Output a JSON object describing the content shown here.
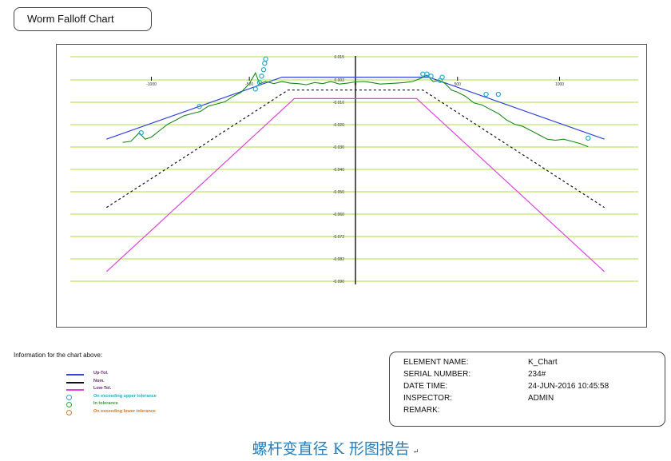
{
  "chart_title": "Worm Falloff Chart",
  "chart_data": {
    "type": "line",
    "title": "Worm Falloff Chart",
    "x_ticks": [
      -1000,
      -520,
      0,
      500,
      1000
    ],
    "x_tick_labels": [
      "-1000",
      "-520",
      "0",
      "500",
      "1000"
    ],
    "y_tick_labels": [
      "0.015",
      "0.002",
      "-0.010",
      "-0.020",
      "-0.030",
      "-0.040",
      "-0.050",
      "-0.060",
      "-0.072",
      "-0.082",
      "-0.090"
    ],
    "xlim": [
      -1250,
      1250
    ],
    "ylim": [
      -0.09,
      0.015
    ],
    "grid": true,
    "series": [
      {
        "name": "Up-Tol.",
        "color": "#3344dd",
        "style": "solid",
        "points": [
          [
            -1220,
            -0.025
          ],
          [
            -360,
            0.004
          ],
          [
            360,
            0.004
          ],
          [
            1220,
            -0.025
          ]
        ]
      },
      {
        "name": "Nom.",
        "color": "#111111",
        "style": "dashed",
        "points": [
          [
            -1220,
            -0.057
          ],
          [
            -330,
            -0.002
          ],
          [
            330,
            -0.002
          ],
          [
            1220,
            -0.057
          ]
        ]
      },
      {
        "name": "Low-Tol.",
        "color": "#dd44dd",
        "style": "solid",
        "points": [
          [
            -1220,
            -0.087
          ],
          [
            -300,
            -0.006
          ],
          [
            300,
            -0.006
          ],
          [
            1220,
            -0.087
          ]
        ]
      },
      {
        "name": "Measured",
        "color": "#1a8a1a",
        "style": "solid",
        "points": [
          [
            -1140,
            -0.0265
          ],
          [
            -1100,
            -0.026
          ],
          [
            -1060,
            -0.022
          ],
          [
            -1030,
            -0.025
          ],
          [
            -1000,
            -0.024
          ],
          [
            -960,
            -0.021
          ],
          [
            -920,
            -0.018
          ],
          [
            -880,
            -0.016
          ],
          [
            -840,
            -0.014
          ],
          [
            -800,
            -0.013
          ],
          [
            -760,
            -0.012
          ],
          [
            -720,
            -0.0095
          ],
          [
            -680,
            -0.0085
          ],
          [
            -640,
            -0.0075
          ],
          [
            -600,
            -0.005
          ],
          [
            -560,
            -0.003
          ],
          [
            -520,
            0.001
          ],
          [
            -490,
            0.006
          ],
          [
            -470,
            0.001
          ],
          [
            -440,
            0.002
          ],
          [
            -400,
            0.001
          ],
          [
            -360,
            0.002
          ],
          [
            -320,
            0.0012
          ],
          [
            -280,
            0.001
          ],
          [
            -240,
            0.0005
          ],
          [
            -200,
            0.0015
          ],
          [
            -160,
            0.001
          ],
          [
            -120,
            0.002
          ],
          [
            -80,
            0.0008
          ],
          [
            -40,
            0.0012
          ],
          [
            0,
            0.0018
          ],
          [
            40,
            0.002
          ],
          [
            80,
            0.0015
          ],
          [
            120,
            0.0008
          ],
          [
            160,
            0.001
          ],
          [
            200,
            0.0012
          ],
          [
            240,
            0.0015
          ],
          [
            280,
            0.002
          ],
          [
            320,
            0.0035
          ],
          [
            350,
            0.005
          ],
          [
            380,
            0.002
          ],
          [
            410,
            0.0025
          ],
          [
            440,
            0.001
          ],
          [
            470,
            -0.002
          ],
          [
            500,
            -0.003
          ],
          [
            540,
            -0.005
          ],
          [
            580,
            -0.008
          ],
          [
            620,
            -0.009
          ],
          [
            660,
            -0.011
          ],
          [
            700,
            -0.013
          ],
          [
            740,
            -0.016
          ],
          [
            780,
            -0.018
          ],
          [
            820,
            -0.019
          ],
          [
            860,
            -0.021
          ],
          [
            900,
            -0.023
          ],
          [
            940,
            -0.025
          ],
          [
            980,
            -0.0255
          ],
          [
            1020,
            -0.025
          ],
          [
            1060,
            -0.026
          ],
          [
            1100,
            -0.027
          ],
          [
            1140,
            -0.0285
          ]
        ]
      }
    ],
    "markers": {
      "exceed_upper": [
        [
          -1050,
          -0.022
        ],
        [
          -765,
          -0.0097
        ],
        [
          -490,
          -0.0015
        ],
        [
          -470,
          0.0015
        ],
        [
          -460,
          0.0045
        ],
        [
          -450,
          0.0075
        ],
        [
          -445,
          0.0105
        ],
        [
          -440,
          0.0125
        ],
        [
          330,
          0.0055
        ],
        [
          350,
          0.0055
        ],
        [
          370,
          0.0045
        ],
        [
          415,
          0.0025
        ],
        [
          425,
          0.004
        ],
        [
          640,
          -0.004
        ],
        [
          700,
          -0.004
        ],
        [
          1140,
          -0.0245
        ]
      ],
      "in_tolerance": [],
      "exceed_lower": []
    }
  },
  "legend": {
    "heading": "Information for the chart above:",
    "items": [
      {
        "label": "Up-Tol.",
        "kind": "line",
        "color": "#3344dd"
      },
      {
        "label": "Nom.",
        "kind": "line",
        "color": "#111111"
      },
      {
        "label": "Low-Tol.",
        "kind": "line",
        "color": "#dd44dd"
      },
      {
        "label": "On exceeding upper tolerance",
        "kind": "circle",
        "color": "#22aacc"
      },
      {
        "label": "In tolerance",
        "kind": "circle",
        "color": "#22aa33"
      },
      {
        "label": "On exceeding lower tolerance",
        "kind": "circle",
        "color": "#dd7722"
      }
    ]
  },
  "info": {
    "element_name_label": "ELEMENT NAME:",
    "element_name": "K_Chart",
    "serial_number_label": "SERIAL NUMBER:",
    "serial_number": "234#",
    "date_time_label": "DATE TIME:",
    "date_time": "24-JUN-2016 10:45:58",
    "inspector_label": "INSPECTOR:",
    "inspector": "ADMIN",
    "remark_label": "REMARK:",
    "remark": ""
  },
  "caption": "螺杆变直径 K 形图报告",
  "caption_mark": "↵"
}
